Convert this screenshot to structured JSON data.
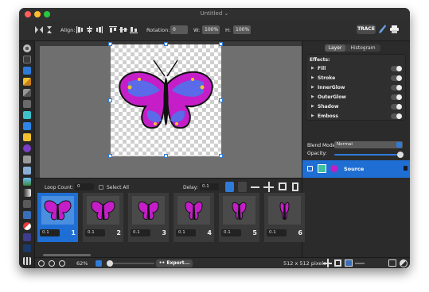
{
  "window": {
    "title": "Untitled"
  },
  "toolbar": {
    "align_label": "Align:",
    "rotation_label": "Rotation:",
    "rotation_value": "0",
    "w_label": "W:",
    "w_value": "100%",
    "h_label": "H:",
    "h_value": "100%",
    "trace_label": "TRACE"
  },
  "panel": {
    "tabs": [
      "Layer",
      "Histogram"
    ],
    "effects_title": "Effects:",
    "effects": [
      "Fill",
      "Stroke",
      "InnerGlow",
      "OuterGlow",
      "Shadow",
      "Emboss"
    ],
    "blend_mode_label": "Blend Mode:",
    "blend_mode_value": "Normal",
    "opacity_label": "Opacity:",
    "layer_name": "Source"
  },
  "frames": {
    "loop_count_label": "Loop Count:",
    "loop_count_value": "0",
    "select_all_label": "Select All",
    "delay_label": "Delay:",
    "delay_value": "0.1",
    "items": [
      {
        "delay": "0.1",
        "num": "1"
      },
      {
        "delay": "0.1",
        "num": "2"
      },
      {
        "delay": "0.1",
        "num": "3"
      },
      {
        "delay": "0.1",
        "num": "4"
      },
      {
        "delay": "0.1",
        "num": "5"
      },
      {
        "delay": "0.1",
        "num": "6"
      }
    ]
  },
  "status": {
    "zoom_value": "62%",
    "export_label": "Export...",
    "dimensions": "512 x 512 pixels"
  },
  "colors": {
    "accent": "#1f6ed4",
    "butterfly_magenta": "#c51ec8",
    "butterfly_blue": "#5a6ae8"
  }
}
